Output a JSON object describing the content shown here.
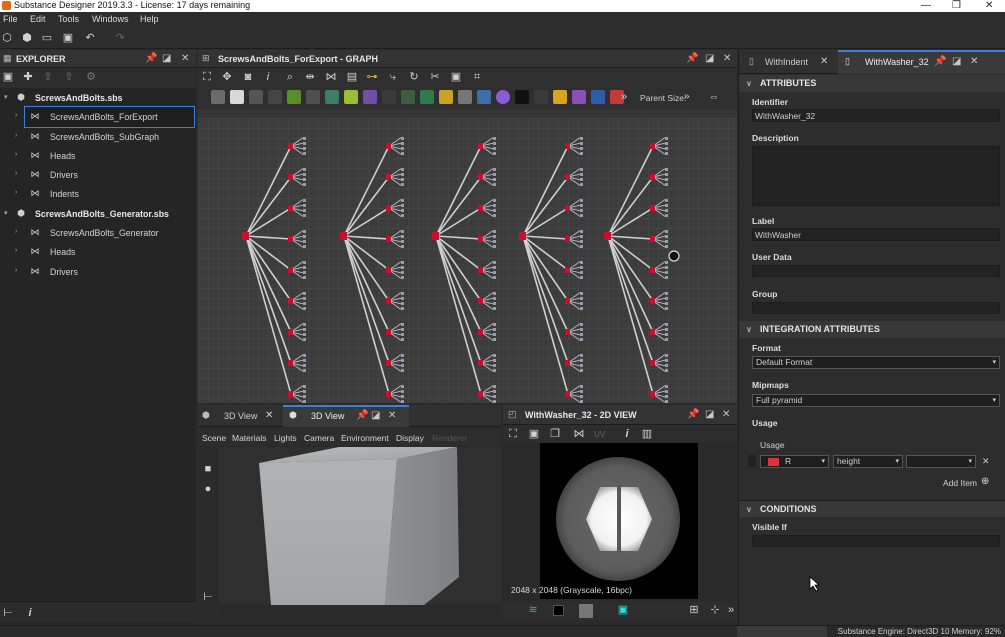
{
  "window": {
    "title": "Substance Designer 2019.3.3 - License: 17 days remaining",
    "minimize": "—",
    "restore": "❐",
    "close": "✕"
  },
  "menu": [
    "File",
    "Edit",
    "Tools",
    "Windows",
    "Help"
  ],
  "explorer": {
    "title": "EXPLORER",
    "items": [
      {
        "label": "ScrewsAndBolts.sbs",
        "level": 0,
        "bold": true
      },
      {
        "label": "ScrewsAndBolts_ForExport",
        "level": 1
      },
      {
        "label": "ScrewsAndBolts_SubGraph",
        "level": 1
      },
      {
        "label": "Heads",
        "level": 1
      },
      {
        "label": "Drivers",
        "level": 1
      },
      {
        "label": "Indents",
        "level": 1
      },
      {
        "label": "ScrewsAndBolts_Generator.sbs",
        "level": 0,
        "bold": true
      },
      {
        "label": "ScrewsAndBolts_Generator",
        "level": 1
      },
      {
        "label": "Heads",
        "level": 1
      },
      {
        "label": "Drivers",
        "level": 1
      }
    ],
    "selected_index": 1
  },
  "graph": {
    "title": "ScrewsAndBolts_ForExport - GRAPH",
    "parent_size_label": "Parent Size:",
    "parent_size_value": "»"
  },
  "view3d": {
    "tabs": [
      "3D View",
      "3D View"
    ],
    "menu": [
      "Scene",
      "Materials",
      "Lights",
      "Camera",
      "Environment",
      "Display",
      "Renderer"
    ]
  },
  "view2d": {
    "title": "WithWasher_32 - 2D VIEW",
    "uv_label": "UV",
    "info": "2048 x 2048 (Grayscale, 16bpc)"
  },
  "properties": {
    "tabs": [
      "WithIndent",
      "WithWasher_32"
    ],
    "sections": {
      "attributes": "ATTRIBUTES",
      "integration": "INTEGRATION ATTRIBUTES",
      "conditions": "CONDITIONS"
    },
    "fields": {
      "identifier_label": "Identifier",
      "identifier_value": "WithWasher_32",
      "description_label": "Description",
      "label_label": "Label",
      "label_value": "WithWasher",
      "userdata_label": "User Data",
      "group_label": "Group",
      "format_label": "Format",
      "format_value": "Default Format",
      "mipmaps_label": "Mipmaps",
      "mipmaps_value": "Full pyramid",
      "usage_label": "Usage",
      "usage_sub": "Usage",
      "usage_channel": "R",
      "usage_name": "height",
      "add_item": "Add Item",
      "visibleif_label": "Visible If"
    },
    "usage_color": "#d9353b"
  },
  "status": {
    "engine": "Substance Engine: Direct3D 10  Memory: 92%"
  },
  "colors": {
    "accent": "#3d7fd8",
    "node_red": "#c8102e"
  }
}
